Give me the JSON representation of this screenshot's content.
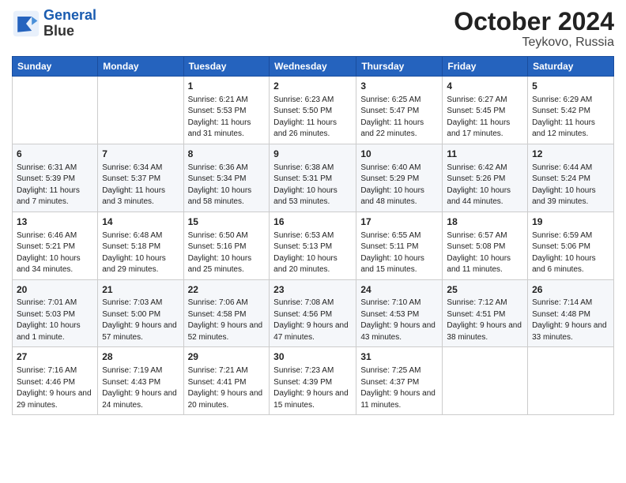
{
  "header": {
    "logo_line1": "General",
    "logo_line2": "Blue",
    "title": "October 2024",
    "subtitle": "Teykovo, Russia"
  },
  "weekdays": [
    "Sunday",
    "Monday",
    "Tuesday",
    "Wednesday",
    "Thursday",
    "Friday",
    "Saturday"
  ],
  "weeks": [
    [
      {
        "day": "",
        "info": ""
      },
      {
        "day": "",
        "info": ""
      },
      {
        "day": "1",
        "info": "Sunrise: 6:21 AM\nSunset: 5:53 PM\nDaylight: 11 hours and 31 minutes."
      },
      {
        "day": "2",
        "info": "Sunrise: 6:23 AM\nSunset: 5:50 PM\nDaylight: 11 hours and 26 minutes."
      },
      {
        "day": "3",
        "info": "Sunrise: 6:25 AM\nSunset: 5:47 PM\nDaylight: 11 hours and 22 minutes."
      },
      {
        "day": "4",
        "info": "Sunrise: 6:27 AM\nSunset: 5:45 PM\nDaylight: 11 hours and 17 minutes."
      },
      {
        "day": "5",
        "info": "Sunrise: 6:29 AM\nSunset: 5:42 PM\nDaylight: 11 hours and 12 minutes."
      }
    ],
    [
      {
        "day": "6",
        "info": "Sunrise: 6:31 AM\nSunset: 5:39 PM\nDaylight: 11 hours and 7 minutes."
      },
      {
        "day": "7",
        "info": "Sunrise: 6:34 AM\nSunset: 5:37 PM\nDaylight: 11 hours and 3 minutes."
      },
      {
        "day": "8",
        "info": "Sunrise: 6:36 AM\nSunset: 5:34 PM\nDaylight: 10 hours and 58 minutes."
      },
      {
        "day": "9",
        "info": "Sunrise: 6:38 AM\nSunset: 5:31 PM\nDaylight: 10 hours and 53 minutes."
      },
      {
        "day": "10",
        "info": "Sunrise: 6:40 AM\nSunset: 5:29 PM\nDaylight: 10 hours and 48 minutes."
      },
      {
        "day": "11",
        "info": "Sunrise: 6:42 AM\nSunset: 5:26 PM\nDaylight: 10 hours and 44 minutes."
      },
      {
        "day": "12",
        "info": "Sunrise: 6:44 AM\nSunset: 5:24 PM\nDaylight: 10 hours and 39 minutes."
      }
    ],
    [
      {
        "day": "13",
        "info": "Sunrise: 6:46 AM\nSunset: 5:21 PM\nDaylight: 10 hours and 34 minutes."
      },
      {
        "day": "14",
        "info": "Sunrise: 6:48 AM\nSunset: 5:18 PM\nDaylight: 10 hours and 29 minutes."
      },
      {
        "day": "15",
        "info": "Sunrise: 6:50 AM\nSunset: 5:16 PM\nDaylight: 10 hours and 25 minutes."
      },
      {
        "day": "16",
        "info": "Sunrise: 6:53 AM\nSunset: 5:13 PM\nDaylight: 10 hours and 20 minutes."
      },
      {
        "day": "17",
        "info": "Sunrise: 6:55 AM\nSunset: 5:11 PM\nDaylight: 10 hours and 15 minutes."
      },
      {
        "day": "18",
        "info": "Sunrise: 6:57 AM\nSunset: 5:08 PM\nDaylight: 10 hours and 11 minutes."
      },
      {
        "day": "19",
        "info": "Sunrise: 6:59 AM\nSunset: 5:06 PM\nDaylight: 10 hours and 6 minutes."
      }
    ],
    [
      {
        "day": "20",
        "info": "Sunrise: 7:01 AM\nSunset: 5:03 PM\nDaylight: 10 hours and 1 minute."
      },
      {
        "day": "21",
        "info": "Sunrise: 7:03 AM\nSunset: 5:00 PM\nDaylight: 9 hours and 57 minutes."
      },
      {
        "day": "22",
        "info": "Sunrise: 7:06 AM\nSunset: 4:58 PM\nDaylight: 9 hours and 52 minutes."
      },
      {
        "day": "23",
        "info": "Sunrise: 7:08 AM\nSunset: 4:56 PM\nDaylight: 9 hours and 47 minutes."
      },
      {
        "day": "24",
        "info": "Sunrise: 7:10 AM\nSunset: 4:53 PM\nDaylight: 9 hours and 43 minutes."
      },
      {
        "day": "25",
        "info": "Sunrise: 7:12 AM\nSunset: 4:51 PM\nDaylight: 9 hours and 38 minutes."
      },
      {
        "day": "26",
        "info": "Sunrise: 7:14 AM\nSunset: 4:48 PM\nDaylight: 9 hours and 33 minutes."
      }
    ],
    [
      {
        "day": "27",
        "info": "Sunrise: 7:16 AM\nSunset: 4:46 PM\nDaylight: 9 hours and 29 minutes."
      },
      {
        "day": "28",
        "info": "Sunrise: 7:19 AM\nSunset: 4:43 PM\nDaylight: 9 hours and 24 minutes."
      },
      {
        "day": "29",
        "info": "Sunrise: 7:21 AM\nSunset: 4:41 PM\nDaylight: 9 hours and 20 minutes."
      },
      {
        "day": "30",
        "info": "Sunrise: 7:23 AM\nSunset: 4:39 PM\nDaylight: 9 hours and 15 minutes."
      },
      {
        "day": "31",
        "info": "Sunrise: 7:25 AM\nSunset: 4:37 PM\nDaylight: 9 hours and 11 minutes."
      },
      {
        "day": "",
        "info": ""
      },
      {
        "day": "",
        "info": ""
      }
    ]
  ]
}
